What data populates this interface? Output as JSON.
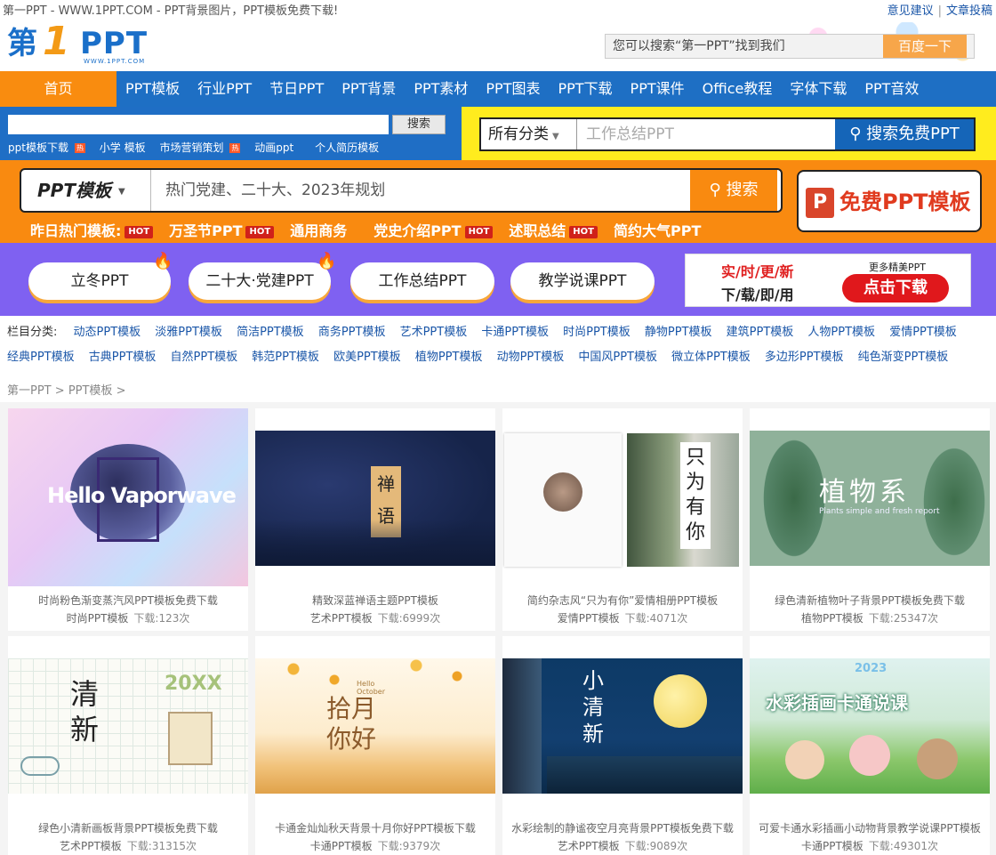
{
  "top": {
    "site_title": "第一PPT - WWW.1PPT.COM - PPT背景图片，PPT模板免费下载!",
    "link_feedback": "意见建议",
    "separator": "|",
    "link_submit": "文章投稿"
  },
  "header": {
    "logo_part1": "第",
    "logo_part2": "1",
    "logo_part3": "PPT",
    "logo_sub": "WWW.1PPT.COM",
    "search_placeholder": "您可以搜索“第一PPT”找到我们",
    "search_button": "百度一下"
  },
  "nav": {
    "home": "首页",
    "items": [
      "PPT模板",
      "行业PPT",
      "节日PPT",
      "PPT背景",
      "PPT素材",
      "PPT图表",
      "PPT下载",
      "PPT课件",
      "Office教程",
      "字体下载",
      "PPT音效"
    ]
  },
  "search1": {
    "button": "搜索",
    "tags": [
      "ppt模板下载",
      "小学 模板",
      "市场营销策划",
      "动画ppt",
      "个人简历模板"
    ]
  },
  "search2": {
    "category": "所有分类",
    "placeholder": "工作总结PPT",
    "button": "搜索免费PPT"
  },
  "banner": {
    "category": "PPT模板",
    "placeholder": "热门党建、二十大、2023年规划",
    "button": "搜索",
    "free_label": "免费PPT模板",
    "free_icon": "P",
    "hot_label": "昨日热门模板:",
    "hot_badge": "HOT",
    "hot_items": [
      "万圣节PPT",
      "通用商务",
      "党史介绍PPT",
      "述职总结",
      "简约大气PPT"
    ]
  },
  "pills": [
    "立冬PPT",
    "二十大·党建PPT",
    "工作总结PPT",
    "教学说课PPT"
  ],
  "ad": {
    "line1": "实/时/更/新",
    "line2": "下/载/即/用",
    "more": "更多精美PPT",
    "cta": "点击下载"
  },
  "categories": {
    "label": "栏目分类:",
    "row1": [
      "动态PPT模板",
      "淡雅PPT模板",
      "简洁PPT模板",
      "商务PPT模板",
      "艺术PPT模板",
      "卡通PPT模板",
      "时尚PPT模板",
      "静物PPT模板",
      "建筑PPT模板",
      "人物PPT模板",
      "爱情PPT模板"
    ],
    "row2": [
      "经典PPT模板",
      "古典PPT模板",
      "自然PPT模板",
      "韩范PPT模板",
      "欧美PPT模板",
      "植物PPT模板",
      "动物PPT模板",
      "中国风PPT模板",
      "微立体PPT模板",
      "多边形PPT模板",
      "纯色渐变PPT模板"
    ]
  },
  "breadcrumb": {
    "home": "第一PPT",
    "sep": ">",
    "current": "PPT模板"
  },
  "download_label": "下载:",
  "download_suffix": "次",
  "cards": [
    {
      "title": "时尚粉色渐变蒸汽风PPT模板免费下载",
      "category": "时尚PPT模板",
      "downloads": "123",
      "thumb_text": "Hello Vaporwave"
    },
    {
      "title": "精致深蓝禅语主题PPT模板",
      "category": "艺术PPT模板",
      "downloads": "6999",
      "thumb_text": "禅语"
    },
    {
      "title": "简约杂志风“只为有你”爱情相册PPT模板",
      "category": "爱情PPT模板",
      "downloads": "4071",
      "thumb_text": "只为有你"
    },
    {
      "title": "绿色清新植物叶子背景PPT模板免费下载",
      "category": "植物PPT模板",
      "downloads": "25347",
      "thumb_text": "植物系"
    },
    {
      "title": "绿色小清新画板背景PPT模板免费下载",
      "category": "艺术PPT模板",
      "downloads": "31315",
      "thumb_text": "清新"
    },
    {
      "title": "卡通金灿灿秋天背景十月你好PPT模板下载",
      "category": "卡通PPT模板",
      "downloads": "9379",
      "thumb_text": "拾月你好"
    },
    {
      "title": "水彩绘制的静谧夜空月亮背景PPT模板免费下载",
      "category": "艺术PPT模板",
      "downloads": "9089",
      "thumb_text": "小清新"
    },
    {
      "title": "可爱卡通水彩插画小动物背景教学说课PPT模板",
      "category": "卡通PPT模板",
      "downloads": "49301",
      "thumb_text": "水彩插画卡通说课"
    }
  ],
  "thumb_extra": {
    "vapor_sub": "",
    "plant_sub": "Plants simple and fresh report",
    "green_year": "20XX",
    "autumn_en": "Hello October",
    "night_kicker": "小清新",
    "animal_year": "2023"
  }
}
